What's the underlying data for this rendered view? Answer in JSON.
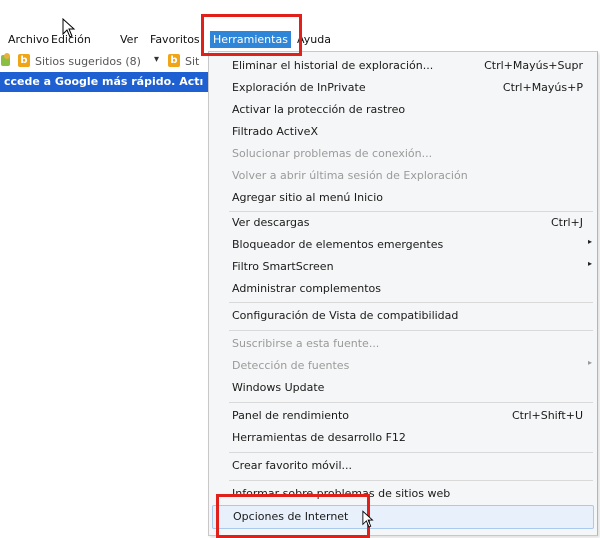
{
  "menubar": {
    "items": [
      "Archivo",
      "Edición",
      "Ver",
      "Favoritos",
      "Herramientas",
      "Ayuda"
    ],
    "active_index": 4
  },
  "favorites_bar": {
    "suggested_sites": "Sitios sugeridos (8)",
    "caret": "▾",
    "second_item": "Sit",
    "bing_glyph": "b"
  },
  "notification": {
    "text": "ccede a Google más rápido. Actı"
  },
  "tools_menu": {
    "items": [
      {
        "label": "Eliminar el historial de exploración...",
        "shortcut": "Ctrl+Mayús+Supr"
      },
      {
        "label": "Exploración de InPrivate",
        "shortcut": "Ctrl+Mayús+P"
      },
      {
        "label": "Activar la protección de rastreo",
        "shortcut": ""
      },
      {
        "label": "Filtrado ActiveX",
        "shortcut": ""
      },
      {
        "label": "Solucionar problemas de conexión...",
        "shortcut": "",
        "disabled": true
      },
      {
        "label": "Volver a abrir última sesión de Exploración",
        "shortcut": "",
        "disabled": true
      },
      {
        "label": "Agregar sitio al menú Inicio",
        "shortcut": ""
      },
      {
        "label": "Ver descargas",
        "shortcut": "Ctrl+J"
      },
      {
        "label": "Bloqueador de elementos emergentes",
        "shortcut": "",
        "submenu": true
      },
      {
        "label": "Filtro SmartScreen",
        "shortcut": "",
        "submenu": true
      },
      {
        "label": "Administrar complementos",
        "shortcut": ""
      },
      {
        "label": "Configuración de Vista de compatibilidad",
        "shortcut": ""
      },
      {
        "label": "Suscribirse a esta fuente...",
        "shortcut": "",
        "disabled": true
      },
      {
        "label": "Detección de fuentes",
        "shortcut": "",
        "submenu": true,
        "disabled": true
      },
      {
        "label": "Windows Update",
        "shortcut": ""
      },
      {
        "label": "Panel de rendimiento",
        "shortcut": "Ctrl+Shift+U"
      },
      {
        "label": "Herramientas de desarrollo F12",
        "shortcut": ""
      },
      {
        "label": "Crear favorito móvil...",
        "shortcut": ""
      },
      {
        "label": "Informar sobre problemas de sitios web",
        "shortcut": ""
      },
      {
        "label": "Opciones de Internet",
        "shortcut": "",
        "highlighted": true
      }
    ],
    "submenu_arrow": "▸"
  },
  "colors": {
    "accent": "#2f86d8",
    "annotation_red": "#e0211b",
    "notification_bg": "#1e5fd1",
    "menu_bg": "#f5f6f7",
    "highlight_bg": "#e8f1fb"
  }
}
